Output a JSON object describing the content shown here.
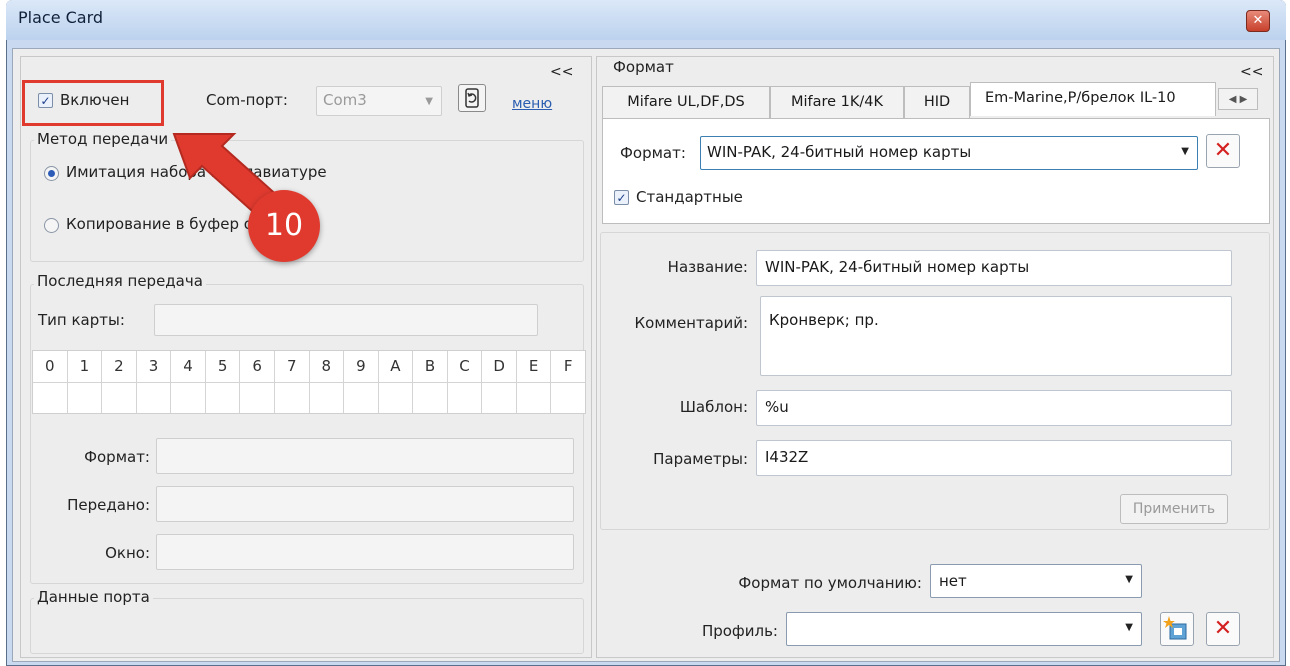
{
  "window": {
    "title": "Place Card",
    "close_symbol": "✕"
  },
  "left": {
    "collapse": "<<",
    "enabled_checkbox": {
      "label": "Включен",
      "checked": true
    },
    "com_port": {
      "label": "Com-порт:",
      "value": "Com3"
    },
    "menu_link": "меню",
    "method_group": {
      "title": "Метод передачи",
      "options": [
        "Имитация набора на клавиатуре",
        "Копирование в буфер обмена"
      ],
      "selected": 0
    },
    "last_transfer": {
      "title": "Последняя передача",
      "card_type_label": "Тип карты:",
      "hex_headers": [
        "0",
        "1",
        "2",
        "3",
        "4",
        "5",
        "6",
        "7",
        "8",
        "9",
        "A",
        "B",
        "C",
        "D",
        "E",
        "F"
      ],
      "format_label": "Формат:",
      "transferred_label": "Передано:",
      "window_label": "Окно:"
    },
    "port_data": {
      "title": "Данные порта"
    }
  },
  "annotation": {
    "number": "10",
    "color": "#e03a2f"
  },
  "right": {
    "collapse": "<<",
    "group_title": "Формат",
    "tabs": [
      "Mifare UL,DF,DS",
      "Mifare 1K/4K",
      "HID",
      "Em-Marine,P/брелок IL-10"
    ],
    "active_tab": 3,
    "format_select": {
      "label": "Формат:",
      "value": "WIN-PAK, 24-битный номер карты"
    },
    "standard_checkbox": {
      "label": "Стандартные",
      "checked": true
    },
    "name": {
      "label": "Название:",
      "value": "WIN-PAK, 24-битный номер карты"
    },
    "comment": {
      "label": "Комментарий:",
      "value": "Кронверк; пр."
    },
    "template": {
      "label": "Шаблон:",
      "value": "%u"
    },
    "params": {
      "label": "Параметры:",
      "value": "I432Z"
    },
    "apply_button": "Применить",
    "default_format": {
      "label": "Формат по умолчанию:",
      "value": "нет"
    },
    "profile": {
      "label": "Профиль:",
      "value": ""
    }
  }
}
